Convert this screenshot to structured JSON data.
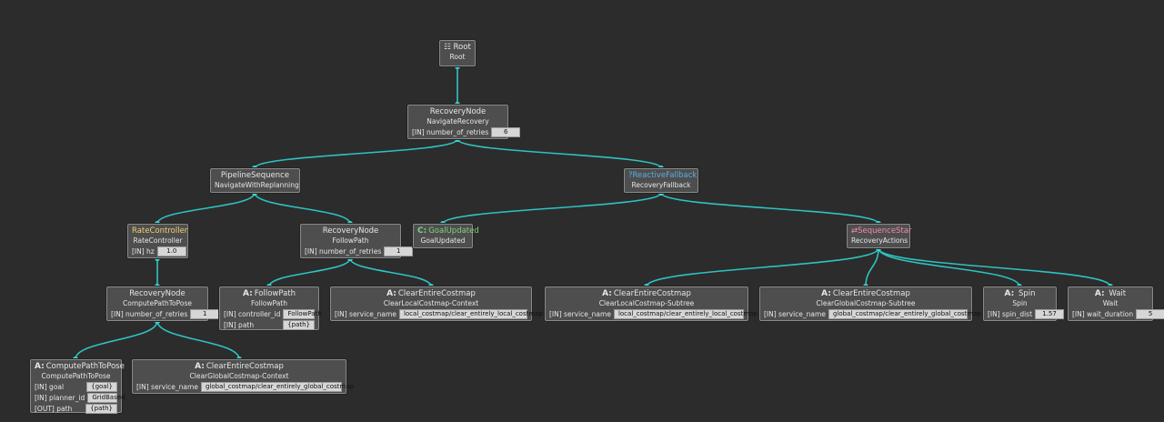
{
  "colors": {
    "edge": "#2fc2c2",
    "reactive_title": "#5aaee0",
    "condition_title": "#7ed07e",
    "decorator_title": "#f0d070",
    "sequence_star_title": "#f08ab0",
    "action_badge": "#ffffff"
  },
  "nodes": {
    "root": {
      "title": "Root",
      "name": "Root",
      "icon": "tree-icon"
    },
    "nav_recovery": {
      "title": "RecoveryNode",
      "name": "NavigateRecovery",
      "ports": [
        {
          "label": "[IN] number_of_retries",
          "value": "6"
        }
      ]
    },
    "pipeline": {
      "title": "PipelineSequence",
      "name": "NavigateWithReplanning"
    },
    "reactive": {
      "title": "ReactiveFallback",
      "name": "RecoveryFallback",
      "icon": "reactive-fallback-icon"
    },
    "rate": {
      "title": "RateController",
      "name": "RateController",
      "ports": [
        {
          "label": "[IN] hz",
          "value": "1.0"
        }
      ]
    },
    "followpath_recovery": {
      "title": "RecoveryNode",
      "name": "FollowPath",
      "ports": [
        {
          "label": "[IN] number_of_retries",
          "value": "1"
        }
      ]
    },
    "goal_updated": {
      "badge": "C:",
      "title": "GoalUpdated",
      "name": "GoalUpdated"
    },
    "sequence_star": {
      "title": "SequenceStar",
      "name": "RecoveryActions",
      "icon": "sequence-star-icon"
    },
    "compute_recovery": {
      "title": "RecoveryNode",
      "name": "ComputePathToPose",
      "ports": [
        {
          "label": "[IN] number_of_retries",
          "value": "1"
        }
      ]
    },
    "followpath_action": {
      "badge": "A:",
      "title": "FollowPath",
      "name": "FollowPath",
      "ports": [
        {
          "label": "[IN] controller_id",
          "value": "FollowPath"
        },
        {
          "label": "[IN] path",
          "value": "{path}"
        }
      ]
    },
    "clear_local_ctx": {
      "badge": "A:",
      "title": "ClearEntireCostmap",
      "name": "ClearLocalCostmap-Context",
      "ports": [
        {
          "label": "[IN] service_name",
          "value": "local_costmap/clear_entirely_local_costmap"
        }
      ]
    },
    "clear_local_sub": {
      "badge": "A:",
      "title": "ClearEntireCostmap",
      "name": "ClearLocalCostmap-Subtree",
      "ports": [
        {
          "label": "[IN] service_name",
          "value": "local_costmap/clear_entirely_local_costmap"
        }
      ]
    },
    "clear_global_sub": {
      "badge": "A:",
      "title": "ClearEntireCostmap",
      "name": "ClearGlobalCostmap-Subtree",
      "ports": [
        {
          "label": "[IN] service_name",
          "value": "global_costmap/clear_entirely_global_costmap"
        }
      ]
    },
    "spin": {
      "badge": "A:",
      "title": "Spin",
      "name": "Spin",
      "ports": [
        {
          "label": "[IN] spin_dist",
          "value": "1.57"
        }
      ]
    },
    "wait": {
      "badge": "A:",
      "title": "Wait",
      "name": "Wait",
      "ports": [
        {
          "label": "[IN] wait_duration",
          "value": "5"
        }
      ]
    },
    "compute_action": {
      "badge": "A:",
      "title": "ComputePathToPose",
      "name": "ComputePathToPose",
      "ports": [
        {
          "label": "[IN] goal",
          "value": "{goal}"
        },
        {
          "label": "[IN] planner_id",
          "value": "GridBased"
        },
        {
          "label": "[OUT] path",
          "value": "{path}"
        }
      ]
    },
    "clear_global_ctx": {
      "badge": "A:",
      "title": "ClearEntireCostmap",
      "name": "ClearGlobalCostmap-Context",
      "ports": [
        {
          "label": "[IN] service_name",
          "value": "global_costmap/clear_entirely_global_costmap"
        }
      ]
    }
  }
}
